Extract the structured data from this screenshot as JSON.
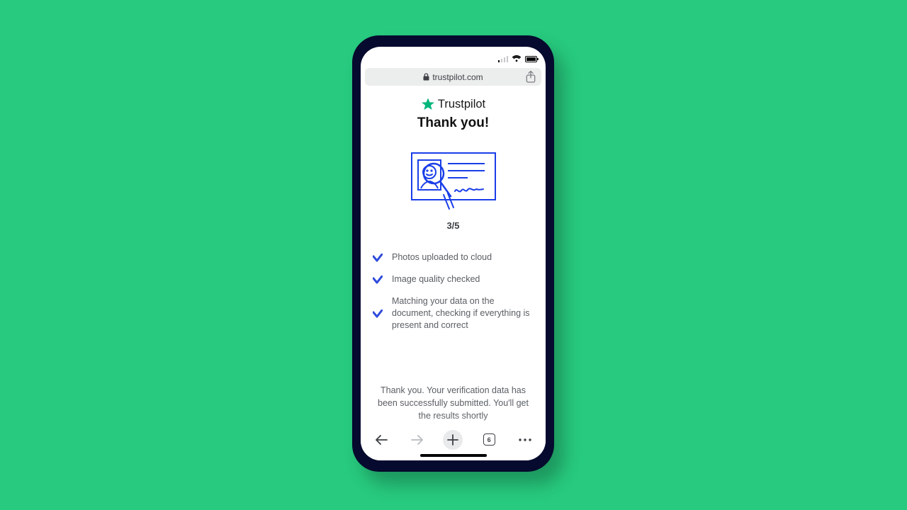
{
  "browser": {
    "url_host": "trustpilot.com",
    "tab_count": "6"
  },
  "page": {
    "brand_name": "Trustpilot",
    "title": "Thank you!",
    "step_indicator": "3/5",
    "steps": [
      "Photos uploaded to cloud",
      "Image quality checked",
      "Matching your data on the document, checking if everything is present and correct"
    ],
    "footer_message": "Thank you. Your verification data has been successfully submitted. You'll get the results shortly"
  },
  "colors": {
    "background": "#27ca7e",
    "phone_frame": "#060a2e",
    "brand_star": "#00b67a",
    "illustration": "#1a3ee8",
    "check_icon": "#2f4bdc"
  }
}
